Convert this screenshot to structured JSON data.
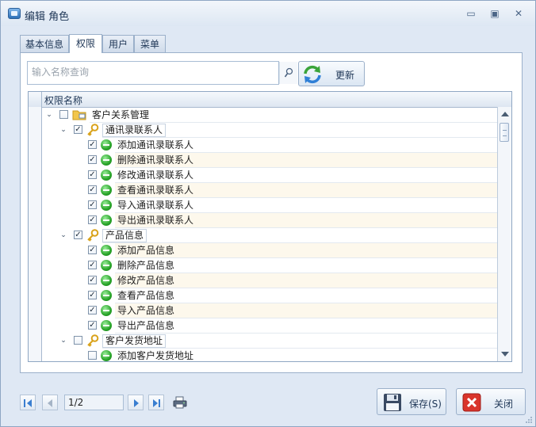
{
  "window": {
    "title": "编辑 角色",
    "min_glyph": "▭",
    "max_glyph": "▣",
    "close_glyph": "✕"
  },
  "tabs": [
    {
      "label": "基本信息",
      "active": false
    },
    {
      "label": "权限",
      "active": true
    },
    {
      "label": "用户",
      "active": false
    },
    {
      "label": "菜单",
      "active": false
    }
  ],
  "search": {
    "placeholder": "输入名称查询",
    "value": "",
    "icon": "search-icon"
  },
  "refresh": {
    "label": "更新",
    "icon": "refresh-icon"
  },
  "grid": {
    "column_header": "权限名称",
    "rows": [
      {
        "level": 0,
        "expanded": true,
        "checked": false,
        "icon": "folder",
        "label": "客户关系管理",
        "current": true,
        "boxed": false
      },
      {
        "level": 1,
        "expanded": true,
        "checked": true,
        "icon": "key",
        "label": "通讯录联系人",
        "boxed": true
      },
      {
        "level": 2,
        "checked": true,
        "icon": "green",
        "label": "添加通讯录联系人"
      },
      {
        "level": 2,
        "checked": true,
        "icon": "green",
        "label": "删除通讯录联系人"
      },
      {
        "level": 2,
        "checked": true,
        "icon": "green",
        "label": "修改通讯录联系人"
      },
      {
        "level": 2,
        "checked": true,
        "icon": "green",
        "label": "查看通讯录联系人"
      },
      {
        "level": 2,
        "checked": true,
        "icon": "green",
        "label": "导入通讯录联系人"
      },
      {
        "level": 2,
        "checked": true,
        "icon": "green",
        "label": "导出通讯录联系人"
      },
      {
        "level": 1,
        "expanded": true,
        "checked": true,
        "icon": "key",
        "label": "产品信息",
        "boxed": true
      },
      {
        "level": 2,
        "checked": true,
        "icon": "green",
        "label": "添加产品信息"
      },
      {
        "level": 2,
        "checked": true,
        "icon": "green",
        "label": "删除产品信息"
      },
      {
        "level": 2,
        "checked": true,
        "icon": "green",
        "label": "修改产品信息"
      },
      {
        "level": 2,
        "checked": true,
        "icon": "green",
        "label": "查看产品信息"
      },
      {
        "level": 2,
        "checked": true,
        "icon": "green",
        "label": "导入产品信息"
      },
      {
        "level": 2,
        "checked": true,
        "icon": "green",
        "label": "导出产品信息"
      },
      {
        "level": 1,
        "expanded": true,
        "checked": false,
        "icon": "key",
        "label": "客户发货地址",
        "boxed": true
      },
      {
        "level": 2,
        "checked": false,
        "icon": "green",
        "label": "添加客户发货地址"
      }
    ]
  },
  "pager": {
    "page_text": "1/2"
  },
  "buttons": {
    "save": "保存(S)",
    "close": "关闭"
  },
  "colors": {
    "accent": "#3a7ed0",
    "window_bg": "#dfe8f4",
    "alt_row": "#fdf8ec"
  }
}
